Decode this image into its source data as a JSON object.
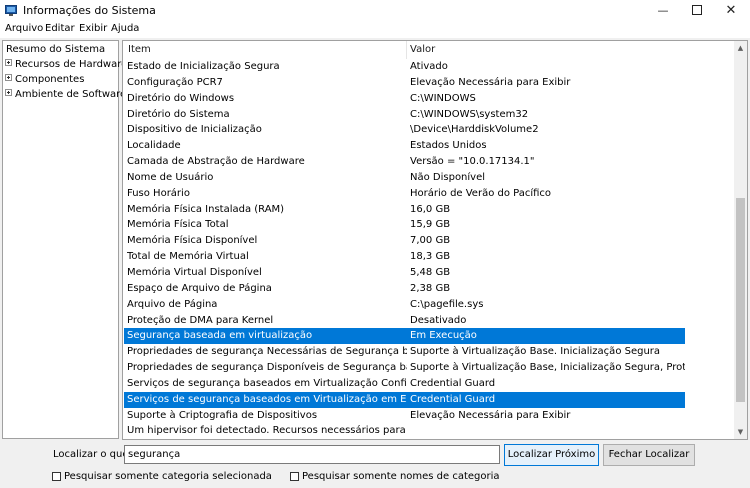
{
  "window": {
    "title": "Informações do Sistema"
  },
  "menu": [
    "Arquivo",
    "Editar",
    "Exibir",
    "Ajuda"
  ],
  "tree": {
    "root": "Resumo do Sistema",
    "children": [
      "Recursos de Hardware",
      "Componentes",
      "Ambiente de Software"
    ]
  },
  "table": {
    "headers": {
      "item": "Item",
      "value": "Valor"
    },
    "rows": [
      {
        "item": "Estado de Inicialização Segura",
        "value": "Ativado",
        "selected": false
      },
      {
        "item": "Configuração PCR7",
        "value": "Elevação Necessária para Exibir",
        "selected": false
      },
      {
        "item": "Diretório do Windows",
        "value": "C:\\WINDOWS",
        "selected": false
      },
      {
        "item": "Diretório do Sistema",
        "value": "C:\\WINDOWS\\system32",
        "selected": false
      },
      {
        "item": "Dispositivo de Inicialização",
        "value": "\\Device\\HarddiskVolume2",
        "selected": false
      },
      {
        "item": "Localidade",
        "value": "Estados Unidos",
        "selected": false
      },
      {
        "item": "Camada de Abstração de Hardware",
        "value": "Versão = \"10.0.17134.1\"",
        "selected": false
      },
      {
        "item": "Nome de Usuário",
        "value": "Não Disponível",
        "selected": false
      },
      {
        "item": "Fuso Horário",
        "value": "Horário de Verão do Pacífico",
        "selected": false
      },
      {
        "item": "Memória Física Instalada (RAM)",
        "value": "16,0 GB",
        "selected": false
      },
      {
        "item": "Memória Física Total",
        "value": "15,9 GB",
        "selected": false
      },
      {
        "item": "Memória Física Disponível",
        "value": "7,00 GB",
        "selected": false
      },
      {
        "item": "Total de Memória Virtual",
        "value": "18,3 GB",
        "selected": false
      },
      {
        "item": "Memória Virtual Disponível",
        "value": "5,48 GB",
        "selected": false
      },
      {
        "item": "Espaço de Arquivo de Página",
        "value": "2,38 GB",
        "selected": false
      },
      {
        "item": "Arquivo de Página",
        "value": "C:\\pagefile.sys",
        "selected": false
      },
      {
        "item": "Proteção de DMA para Kernel",
        "value": "Desativado",
        "selected": false
      },
      {
        "item": "Segurança baseada em virtualização",
        "value": "Em Execução",
        "selected": true
      },
      {
        "item": "Propriedades de segurança Necessárias de Segurança basea...",
        "value": "Suporte à Virtualização Base. Inicialização Segura",
        "selected": false
      },
      {
        "item": "Propriedades de segurança Disponíveis de Segurança basea...",
        "value": "Suporte à Virtualização Base, Inicialização Segura, Proteçã...",
        "selected": false
      },
      {
        "item": "Serviços de segurança baseados em Virtualização Configura...",
        "value": "Credential Guard",
        "selected": false
      },
      {
        "item": "Serviços de segurança baseados em Virtualização em Execução",
        "value": "Credential Guard",
        "selected": true
      },
      {
        "item": "Suporte à Criptografia de Dispositivos",
        "value": "Elevação Necessária para Exibir",
        "selected": false
      },
      {
        "item": "Um hipervisor foi detectado. Recursos necessários para Hypet...",
        "value": "",
        "selected": false
      }
    ]
  },
  "find": {
    "label": "Localizar o que:",
    "value": "segurança",
    "find_next": "Localizar Próximo",
    "close_find": "Fechar Localizar",
    "check_selected_category": "Pesquisar somente categoria selecionada",
    "check_category_names": "Pesquisar somente nomes de categoria"
  },
  "scroll": {
    "position": 0.86,
    "visible_fraction": 0.55
  },
  "colors": {
    "selection": "#0078d7",
    "button_focus_border": "#0078d7"
  }
}
